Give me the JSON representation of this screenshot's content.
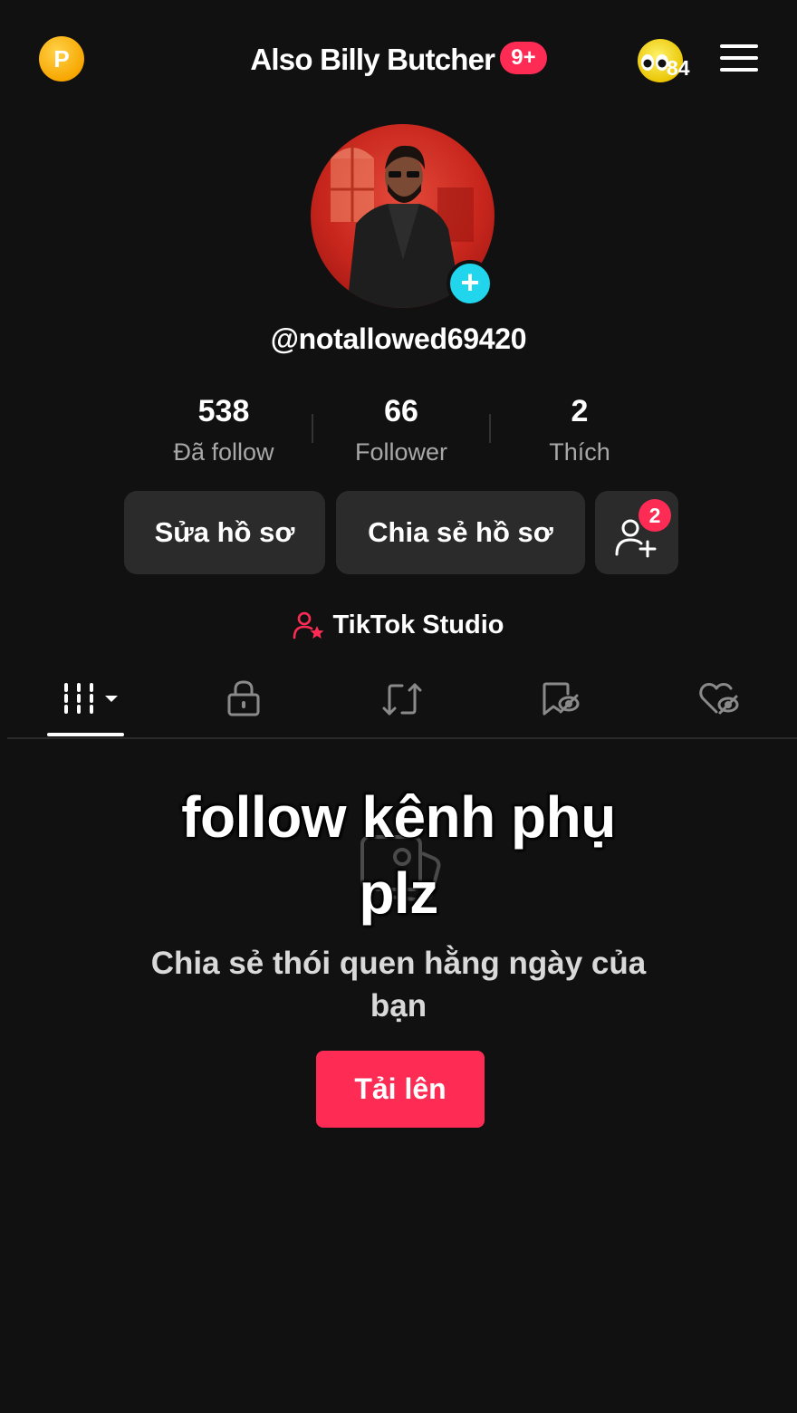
{
  "header": {
    "coin_letter": "P",
    "title": "Also Billy Butcher",
    "notification_badge": "9+",
    "bird_count": "84",
    "menu_icon": "hamburger-menu-icon"
  },
  "profile": {
    "username": "@notallowed69420",
    "avatar_add_icon": "+"
  },
  "stats": [
    {
      "value": "538",
      "label": "Đã follow"
    },
    {
      "value": "66",
      "label": "Follower"
    },
    {
      "value": "2",
      "label": "Thích"
    }
  ],
  "actions": {
    "edit_profile": "Sửa hồ sơ",
    "share_profile": "Chia sẻ hồ sơ",
    "friend_requests_badge": "2"
  },
  "studio": {
    "label": "TikTok Studio"
  },
  "tabs": [
    {
      "icon": "grid-videos-icon",
      "active": true
    },
    {
      "icon": "lock-icon"
    },
    {
      "icon": "repost-icon"
    },
    {
      "icon": "hidden-bookmark-icon"
    },
    {
      "icon": "hidden-heart-icon"
    }
  ],
  "overlay_caption": {
    "line1": "follow kênh phụ",
    "line2": "plz"
  },
  "empty_state": {
    "message": "Chia sẻ thói quen hằng ngày của bạn",
    "upload_button": "Tải lên"
  },
  "colors": {
    "background": "#111111",
    "accent": "#fe2c55",
    "avatar_plus": "#20d5ec",
    "button_bg": "#2b2b2b",
    "muted_text": "#a8a8a8"
  }
}
